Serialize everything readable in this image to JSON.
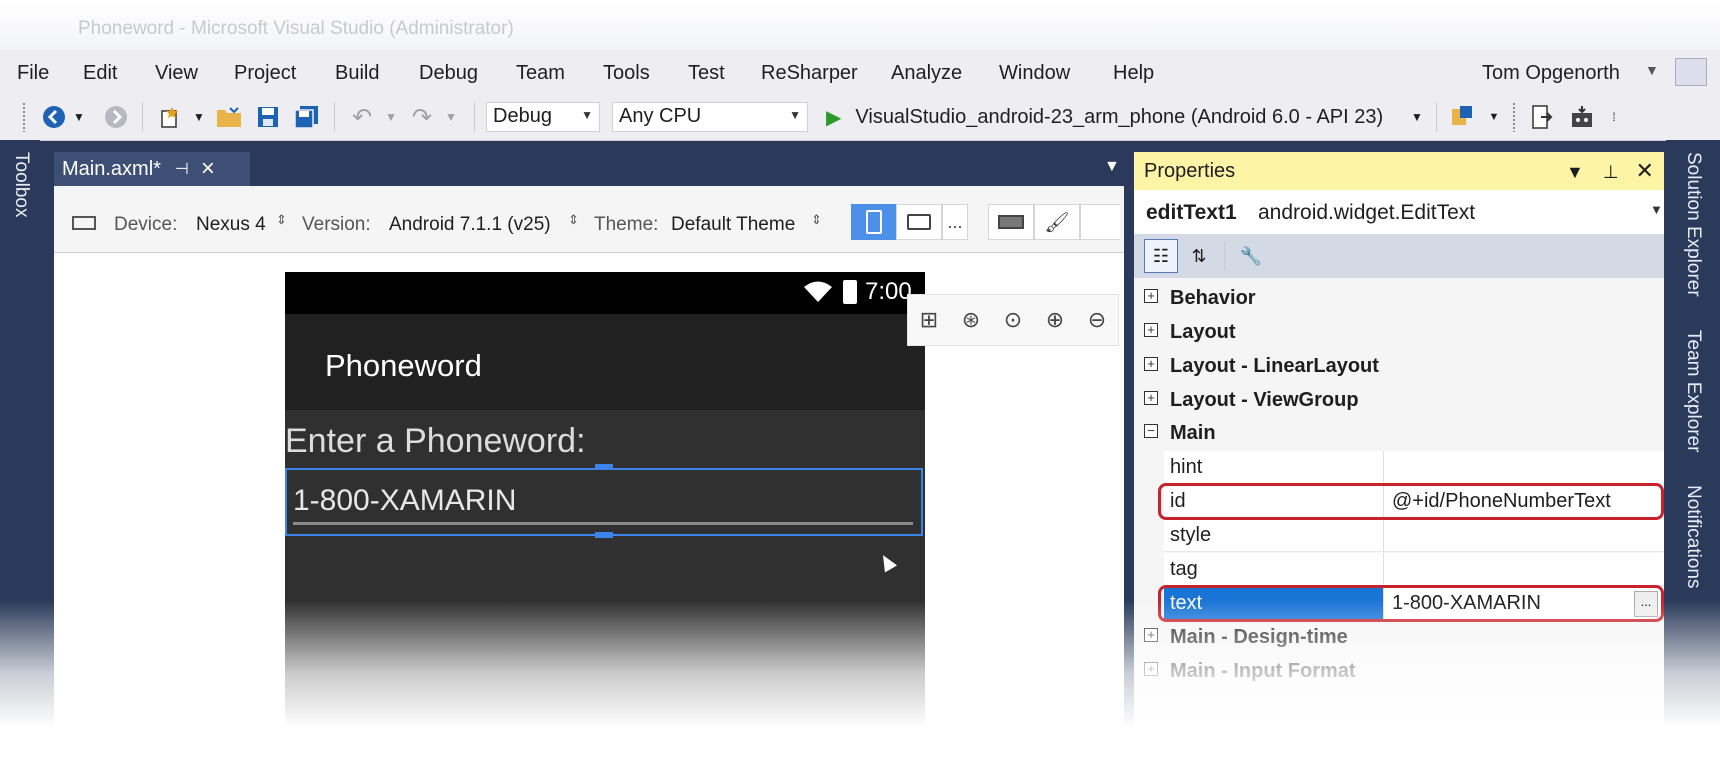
{
  "window": {
    "title": "Phoneword - Microsoft Visual Studio (Administrator)"
  },
  "menu": [
    "File",
    "Edit",
    "View",
    "Project",
    "Build",
    "Debug",
    "Team",
    "Tools",
    "Test",
    "ReSharper",
    "Analyze",
    "Window",
    "Help"
  ],
  "user": {
    "name": "Tom Opgenorth"
  },
  "toolbar": {
    "config": "Debug",
    "platform": "Any CPU",
    "run_target": "VisualStudio_android-23_arm_phone (Android 6.0 - API 23)"
  },
  "side_panels": {
    "left": "Toolbox",
    "right": [
      "Solution Explorer",
      "Team Explorer",
      "Notifications"
    ]
  },
  "document_tab": {
    "label": "Main.axml*"
  },
  "designer": {
    "device_label": "Device:",
    "device": "Nexus 4",
    "version_label": "Version:",
    "version": "Android 7.1.1 (v25)",
    "theme_label": "Theme:",
    "theme": "Default Theme",
    "more": "..."
  },
  "phone": {
    "time": "7:00",
    "app_title": "Phoneword",
    "prompt": "Enter a Phoneword:",
    "edit_text": "1-800-XAMARIN"
  },
  "properties": {
    "title": "Properties",
    "object_name": "editText1",
    "object_type": "android.widget.EditText",
    "categories": {
      "behavior": "Behavior",
      "layout": "Layout",
      "layout_linear": "Layout - LinearLayout",
      "layout_viewgroup": "Layout - ViewGroup",
      "main": "Main",
      "main_design": "Main - Design-time",
      "main_input": "Main - Input Format"
    },
    "rows": {
      "hint": {
        "name": "hint",
        "value": ""
      },
      "id": {
        "name": "id",
        "value": "@+id/PhoneNumberText"
      },
      "style": {
        "name": "style",
        "value": ""
      },
      "tag": {
        "name": "tag",
        "value": ""
      },
      "text": {
        "name": "text",
        "value": "1-800-XAMARIN",
        "button": "..."
      }
    }
  },
  "colors": {
    "accent": "#1a74d6",
    "highlight": "#c8232c",
    "props_header": "#fdf4a6",
    "chrome": "#2b3a5a"
  }
}
